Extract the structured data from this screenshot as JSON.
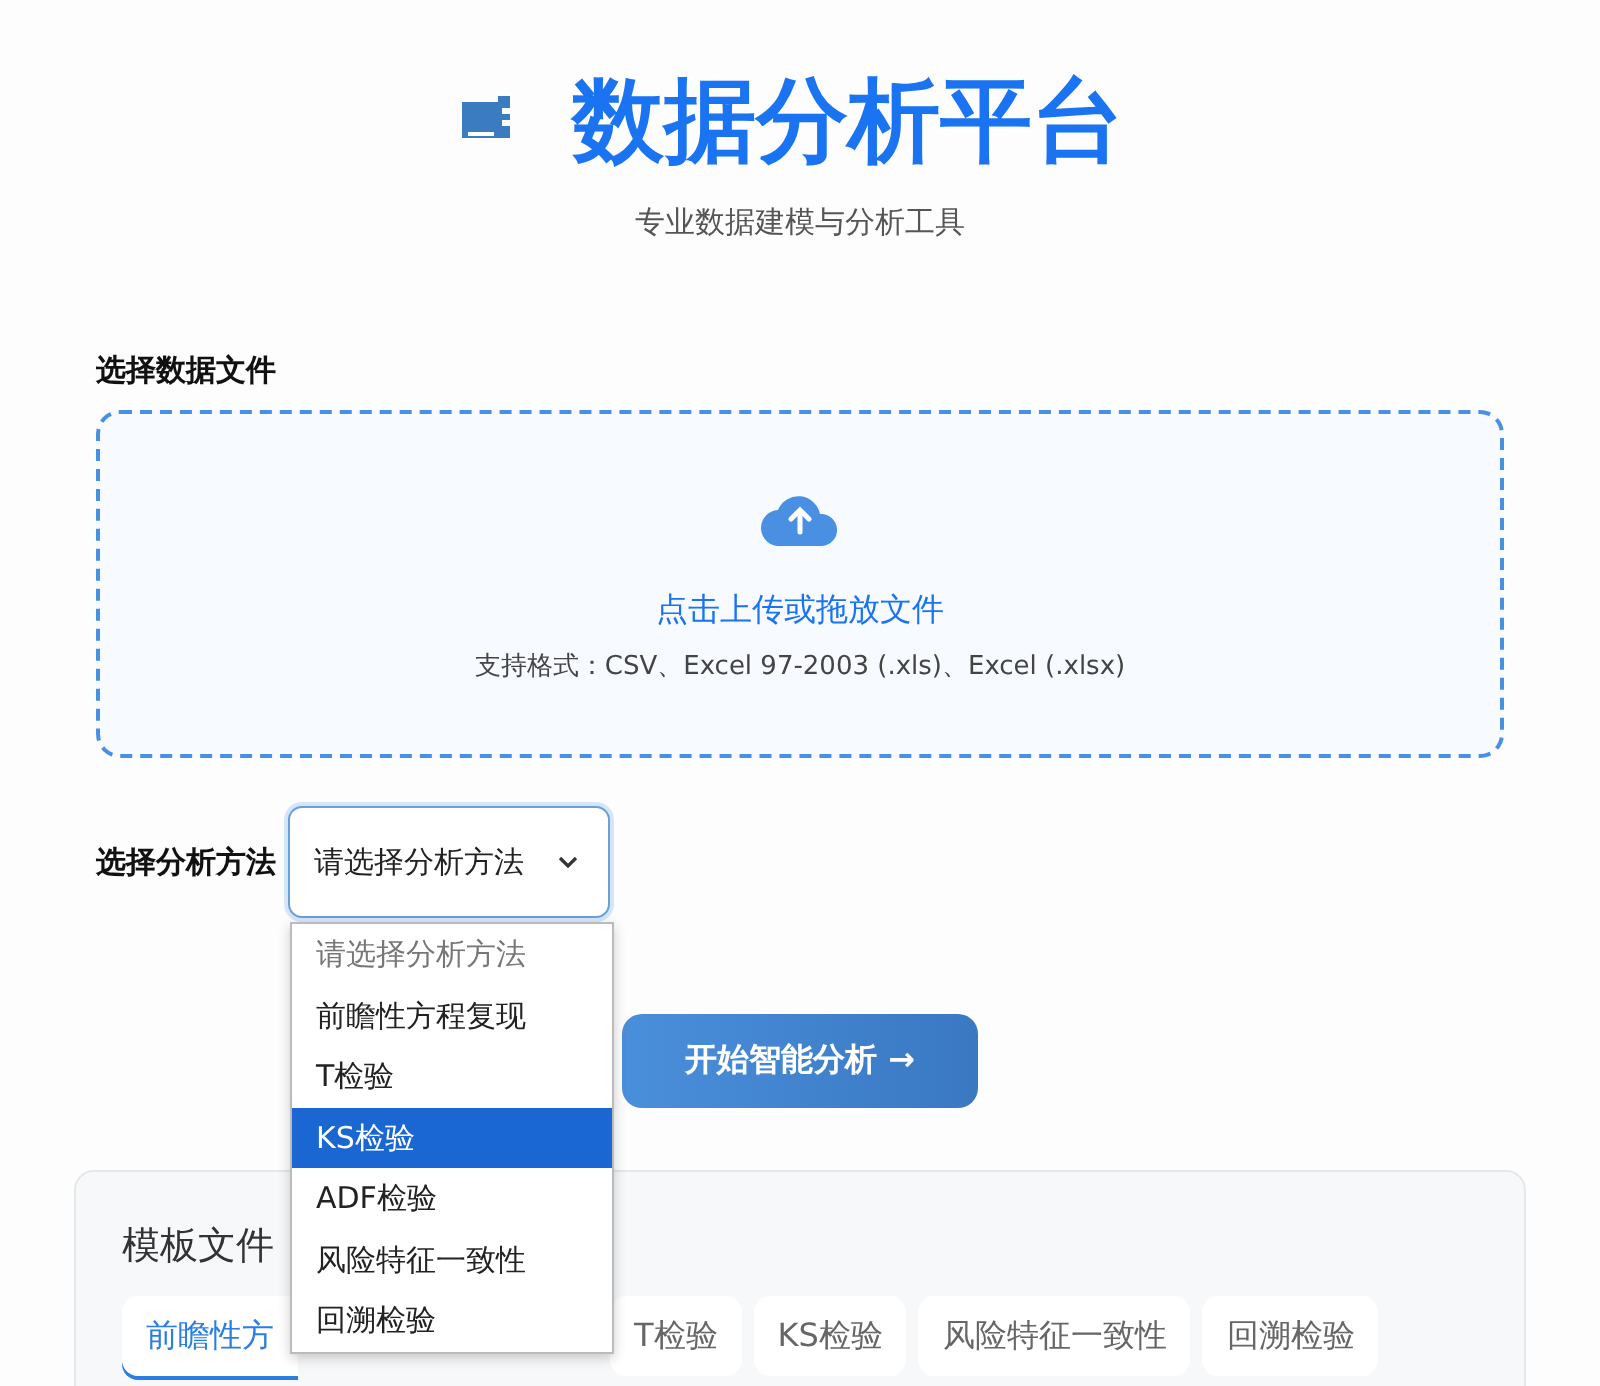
{
  "header": {
    "title": "数据分析平台",
    "subtitle": "专业数据建模与分析工具"
  },
  "upload": {
    "label": "选择数据文件",
    "prompt": "点击上传或拖放文件",
    "formats": "支持格式：CSV、Excel 97-2003 (.xls)、Excel (.xlsx)"
  },
  "method": {
    "label": "选择分析方法",
    "value": "请选择分析方法",
    "expanded": true,
    "options": [
      {
        "label": "请选择分析方法",
        "kind": "placeholder",
        "highlighted": false
      },
      {
        "label": "前瞻性方程复现",
        "kind": "option",
        "highlighted": false
      },
      {
        "label": "T检验",
        "kind": "option",
        "highlighted": false
      },
      {
        "label": "KS检验",
        "kind": "option",
        "highlighted": true
      },
      {
        "label": "ADF检验",
        "kind": "option",
        "highlighted": false
      },
      {
        "label": "风险特征一致性",
        "kind": "option",
        "highlighted": false
      },
      {
        "label": "回溯检验",
        "kind": "option",
        "highlighted": false
      }
    ]
  },
  "start_button": "开始智能分析 →",
  "templates": {
    "title": "模板文件",
    "tabs": [
      {
        "label": "前瞻性方",
        "selected": true
      },
      {
        "label": "T检验",
        "selected": false
      },
      {
        "label": "KS检验",
        "selected": false
      },
      {
        "label": "风险特征一致性",
        "selected": false
      },
      {
        "label": "回溯检验",
        "selected": false
      }
    ]
  }
}
